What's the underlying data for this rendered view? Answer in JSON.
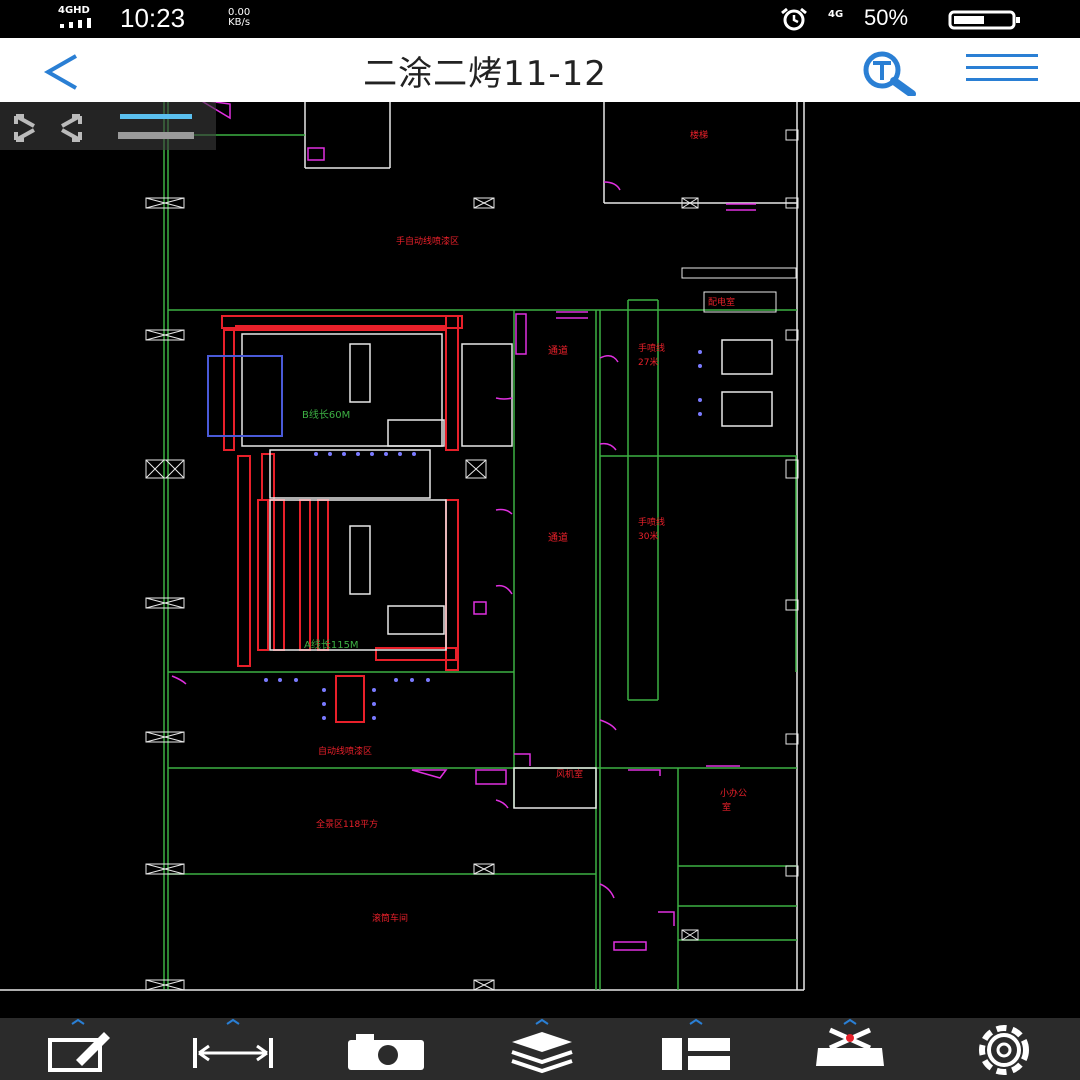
{
  "status_bar": {
    "network": "4GHD",
    "time": "10:23",
    "speed_value": "0.00",
    "speed_unit": "KB/s",
    "network2": "4G",
    "battery": "50%"
  },
  "header": {
    "title": "二涂二烤11-12"
  },
  "drawing": {
    "labels": {
      "top_right_room": "楼梯",
      "upper_spray_area": "手自动线喷漆区",
      "roomlabel_small": "配电室",
      "passage1": "通道",
      "passage2": "通道",
      "hand_line_27_a": "手喷线",
      "hand_line_27_b": "27米",
      "hand_line_30_a": "手喷线",
      "hand_line_30_b": "30米",
      "b_line": "B线长60M",
      "a_line": "A线长115M",
      "auto_spray_area": "自动线喷漆区",
      "blower_room": "风机室",
      "small_office_a": "小办公",
      "small_office_b": "室",
      "full_area": "全景区118平方",
      "bottom_area": "滚筒车间"
    }
  },
  "toolbar": {
    "items": [
      "edit",
      "measure",
      "camera",
      "layers",
      "layout",
      "tools",
      "settings"
    ]
  },
  "colors": {
    "accent": "#2a7fd4",
    "cad_green": "#3cb043",
    "cad_red": "#e8202a",
    "cad_magenta": "#e030e0",
    "cad_white": "#e8e8e8",
    "cad_blue": "#4a5ad8"
  }
}
